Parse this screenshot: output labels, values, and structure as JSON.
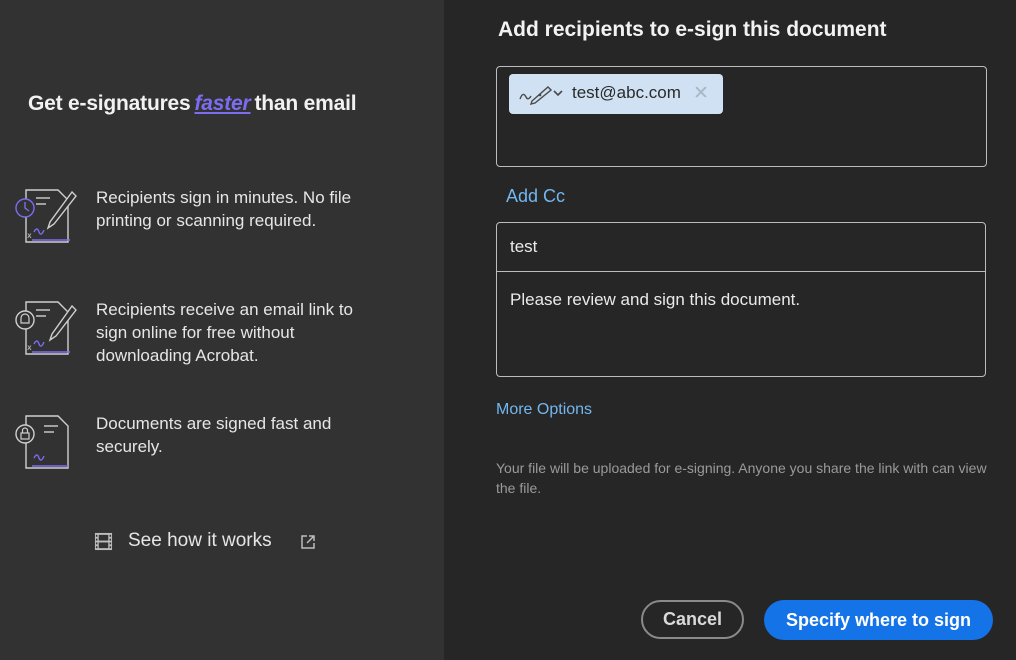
{
  "left": {
    "title_before": "Get e-signatures",
    "title_emphasis": "faster",
    "title_after": "than email",
    "features": [
      {
        "icon": "document-pen-clock-icon",
        "text": "Recipients sign in minutes. No file printing or scanning required."
      },
      {
        "icon": "document-pen-bell-icon",
        "text": "Recipients receive an email link to sign online for free without downloading Acrobat."
      },
      {
        "icon": "document-lock-icon",
        "text": "Documents are signed fast and securely."
      }
    ],
    "how_it_works": {
      "label": "See how it works",
      "icon": "film-icon",
      "link_icon": "external-link-icon"
    }
  },
  "right": {
    "title": "Add recipients to e-sign this document",
    "recipient": {
      "email": "test@abc.com",
      "role_icon": "signature-pen-icon",
      "remove": "✕"
    },
    "add_cc": "Add Cc",
    "subject": "test",
    "message": "Please review and sign this document.",
    "more_options": "More Options",
    "note": "Your file will be uploaded for e-signing. Anyone you share the link with can view the file."
  },
  "buttons": {
    "cancel": "Cancel",
    "primary": "Specify where to sign"
  },
  "colors": {
    "accent": "#1473e6",
    "link": "#73b6ef",
    "emphasis": "#7c6cf0",
    "chip": "#cfe1f3"
  }
}
